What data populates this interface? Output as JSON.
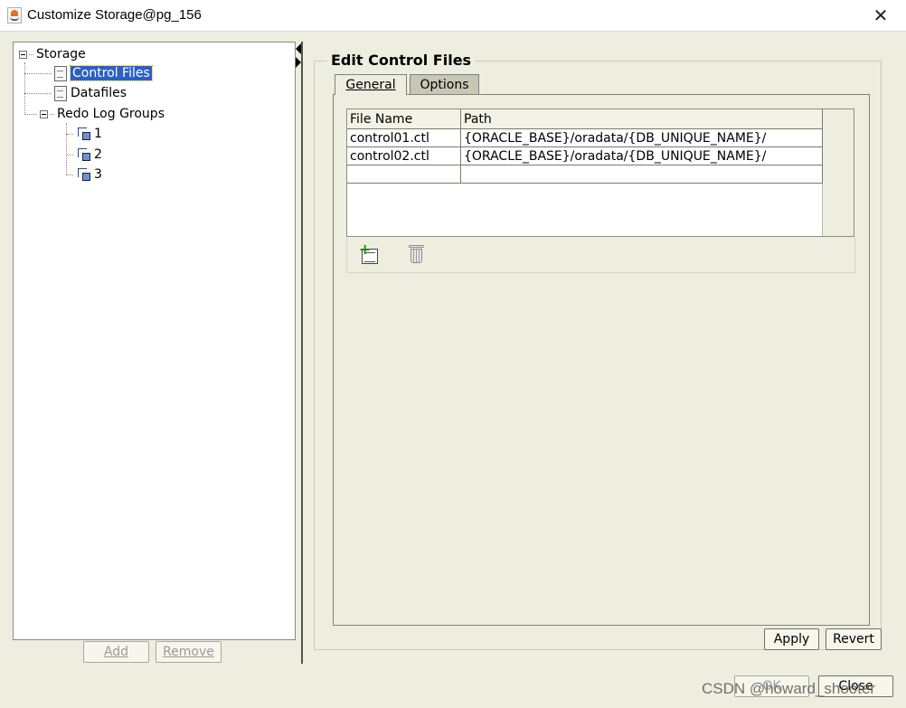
{
  "window": {
    "title": "Customize Storage@pg_156",
    "close_glyph": "✕"
  },
  "tree": {
    "root": "Storage",
    "control_files": "Control Files",
    "datafiles": "Datafiles",
    "redo_log_groups": "Redo Log Groups",
    "groups": [
      "1",
      "2",
      "3"
    ]
  },
  "tree_buttons": {
    "add": "Add",
    "remove": "Remove"
  },
  "edit": {
    "title": "Edit Control Files",
    "tabs": [
      {
        "label": "General",
        "active": true
      },
      {
        "label": "Options",
        "active": false
      }
    ],
    "table": {
      "columns": [
        "File Name",
        "Path"
      ],
      "rows": [
        [
          "control01.ctl",
          "{ORACLE_BASE}/oradata/{DB_UNIQUE_NAME}/"
        ],
        [
          "control02.ctl",
          "{ORACLE_BASE}/oradata/{DB_UNIQUE_NAME}/"
        ],
        [
          "",
          ""
        ]
      ]
    },
    "toolbar_icons": [
      "add-row-icon",
      "delete-icon"
    ]
  },
  "buttons": {
    "apply": "Apply",
    "revert": "Revert",
    "ok": "OK",
    "close": "Close"
  },
  "watermark": "CSDN @howard_shooter",
  "colors": {
    "selection": "#2d5fc6",
    "background": "#eeeee0"
  }
}
